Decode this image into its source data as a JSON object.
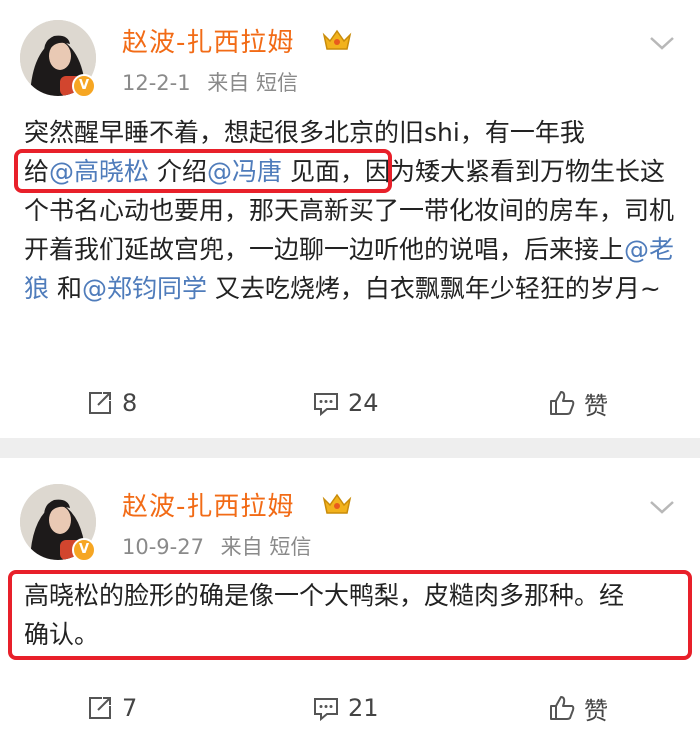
{
  "posts": [
    {
      "username": "赵波-扎西拉姆",
      "verified_badge": "V",
      "date": "12-2-1",
      "source": "来自 短信",
      "content": [
        {
          "t": "突然醒早睡不着，想起很多北京的旧shi，有一年我"
        },
        {
          "t": "给"
        },
        {
          "t": "@高晓松",
          "mention": true
        },
        {
          "t": " 介绍"
        },
        {
          "t": "@冯唐",
          "mention": true
        },
        {
          "t": " 见面"
        },
        {
          "t": "，因为矮大紧看到万物生长这个书名心动也要用，那天高新买了一带化妆间的房车，司机开着我们延故宫兜，一边聊一边听他的说唱，后来接上"
        },
        {
          "t": "@老狼",
          "mention": true
        },
        {
          "t": " 和"
        },
        {
          "t": "@郑钧同学",
          "mention": true
        },
        {
          "t": " 又去吃烧烤，白衣飘飘年少轻狂的岁月~"
        }
      ],
      "repost_count": "8",
      "comment_count": "24",
      "like_label": "赞"
    },
    {
      "username": "赵波-扎西拉姆",
      "verified_badge": "V",
      "date": "10-9-27",
      "source": "来自 短信",
      "content_text": "高晓松的脸形的确是像一个大鸭梨，皮糙肉多那种。经确认。",
      "repost_count": "7",
      "comment_count": "21",
      "like_label": "赞"
    }
  ],
  "colors": {
    "username": "#f26b16",
    "mention": "#4f7cbb",
    "highlight_box": "#e8202a",
    "verified": "#f6a623"
  },
  "icons": [
    "repost-icon",
    "comment-icon",
    "like-icon",
    "chevron-down-icon",
    "crown-icon"
  ]
}
